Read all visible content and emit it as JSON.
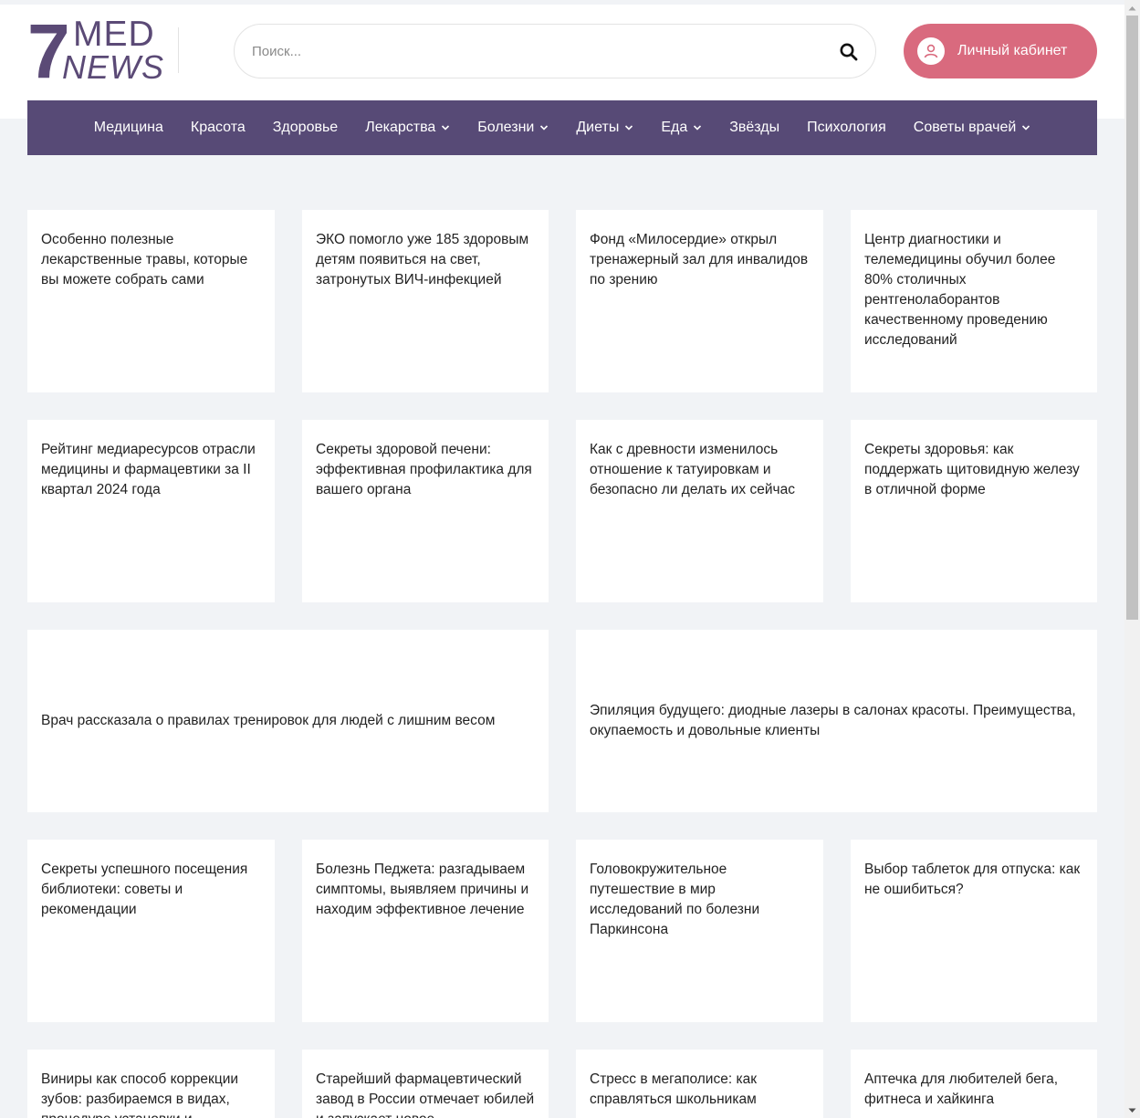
{
  "logo": {
    "seven": "7",
    "med": "MED",
    "news": "NEWS"
  },
  "search": {
    "placeholder": "Поиск...",
    "value": ""
  },
  "account": {
    "label": "Личный кабинет"
  },
  "nav": {
    "items": [
      {
        "label": "Медицина",
        "dropdown": false
      },
      {
        "label": "Красота",
        "dropdown": false
      },
      {
        "label": "Здоровье",
        "dropdown": false
      },
      {
        "label": "Лекарства",
        "dropdown": true
      },
      {
        "label": "Болезни",
        "dropdown": true
      },
      {
        "label": "Диеты",
        "dropdown": true
      },
      {
        "label": "Еда",
        "dropdown": true
      },
      {
        "label": "Звёзды",
        "dropdown": false
      },
      {
        "label": "Психология",
        "dropdown": false
      },
      {
        "label": "Советы врачей",
        "dropdown": true
      }
    ]
  },
  "articles": [
    {
      "title": "Особенно полезные лекарственные травы, которые вы можете собрать сами"
    },
    {
      "title": "ЭКО помогло уже 185 здоровым детям появиться на свет, затронутых ВИЧ-инфекцией"
    },
    {
      "title": "Фонд «Милосердие» открыл тренажерный зал для инвалидов по зрению"
    },
    {
      "title": "Центр диагностики и телемедицины обучил более 80% столичных рентгенолаборантов качественному проведению исследований"
    },
    {
      "title": "Рейтинг медиаресурсов отрасли медицины и фармацевтики за II квартал 2024 года"
    },
    {
      "title": "Секреты здоровой печени: эффективная профилактика для вашего органа"
    },
    {
      "title": "Как с древности изменилось отношение к татуировкам и безопасно ли делать их сейчас"
    },
    {
      "title": "Секреты здоровья: как поддержать щитовидную железу в отличной форме"
    },
    {
      "title": "Врач рассказала о правилах тренировок для людей с лишним весом"
    },
    {
      "title": "Эпиляция будущего: диодные лазеры в салонах красоты. Преимущества, окупаемость и довольные клиенты"
    },
    {
      "title": "Секреты успешного посещения библиотеки: советы и рекомендации"
    },
    {
      "title": "Болезнь Педжета: разгадываем симптомы, выявляем причины и находим эффективное лечение"
    },
    {
      "title": "Головокружительное путешествие в мир исследований по болезни Паркинсона"
    },
    {
      "title": "Выбор таблеток для отпуска: как не ошибиться?"
    },
    {
      "title": "Виниры как способ коррекции зубов: разбираемся в видах, процедуре установки и"
    },
    {
      "title": "Старейший фармацевтический завод в России отмечает юбилей и запускает новое"
    },
    {
      "title": "Стресс в мегаполисе: как справляться школьникам"
    },
    {
      "title": "Аптечка для любителей бега, фитнеса и хайкинга"
    }
  ],
  "colors": {
    "brand": "#574a76",
    "accent": "#d96a7e",
    "background": "#f1f3f6"
  }
}
